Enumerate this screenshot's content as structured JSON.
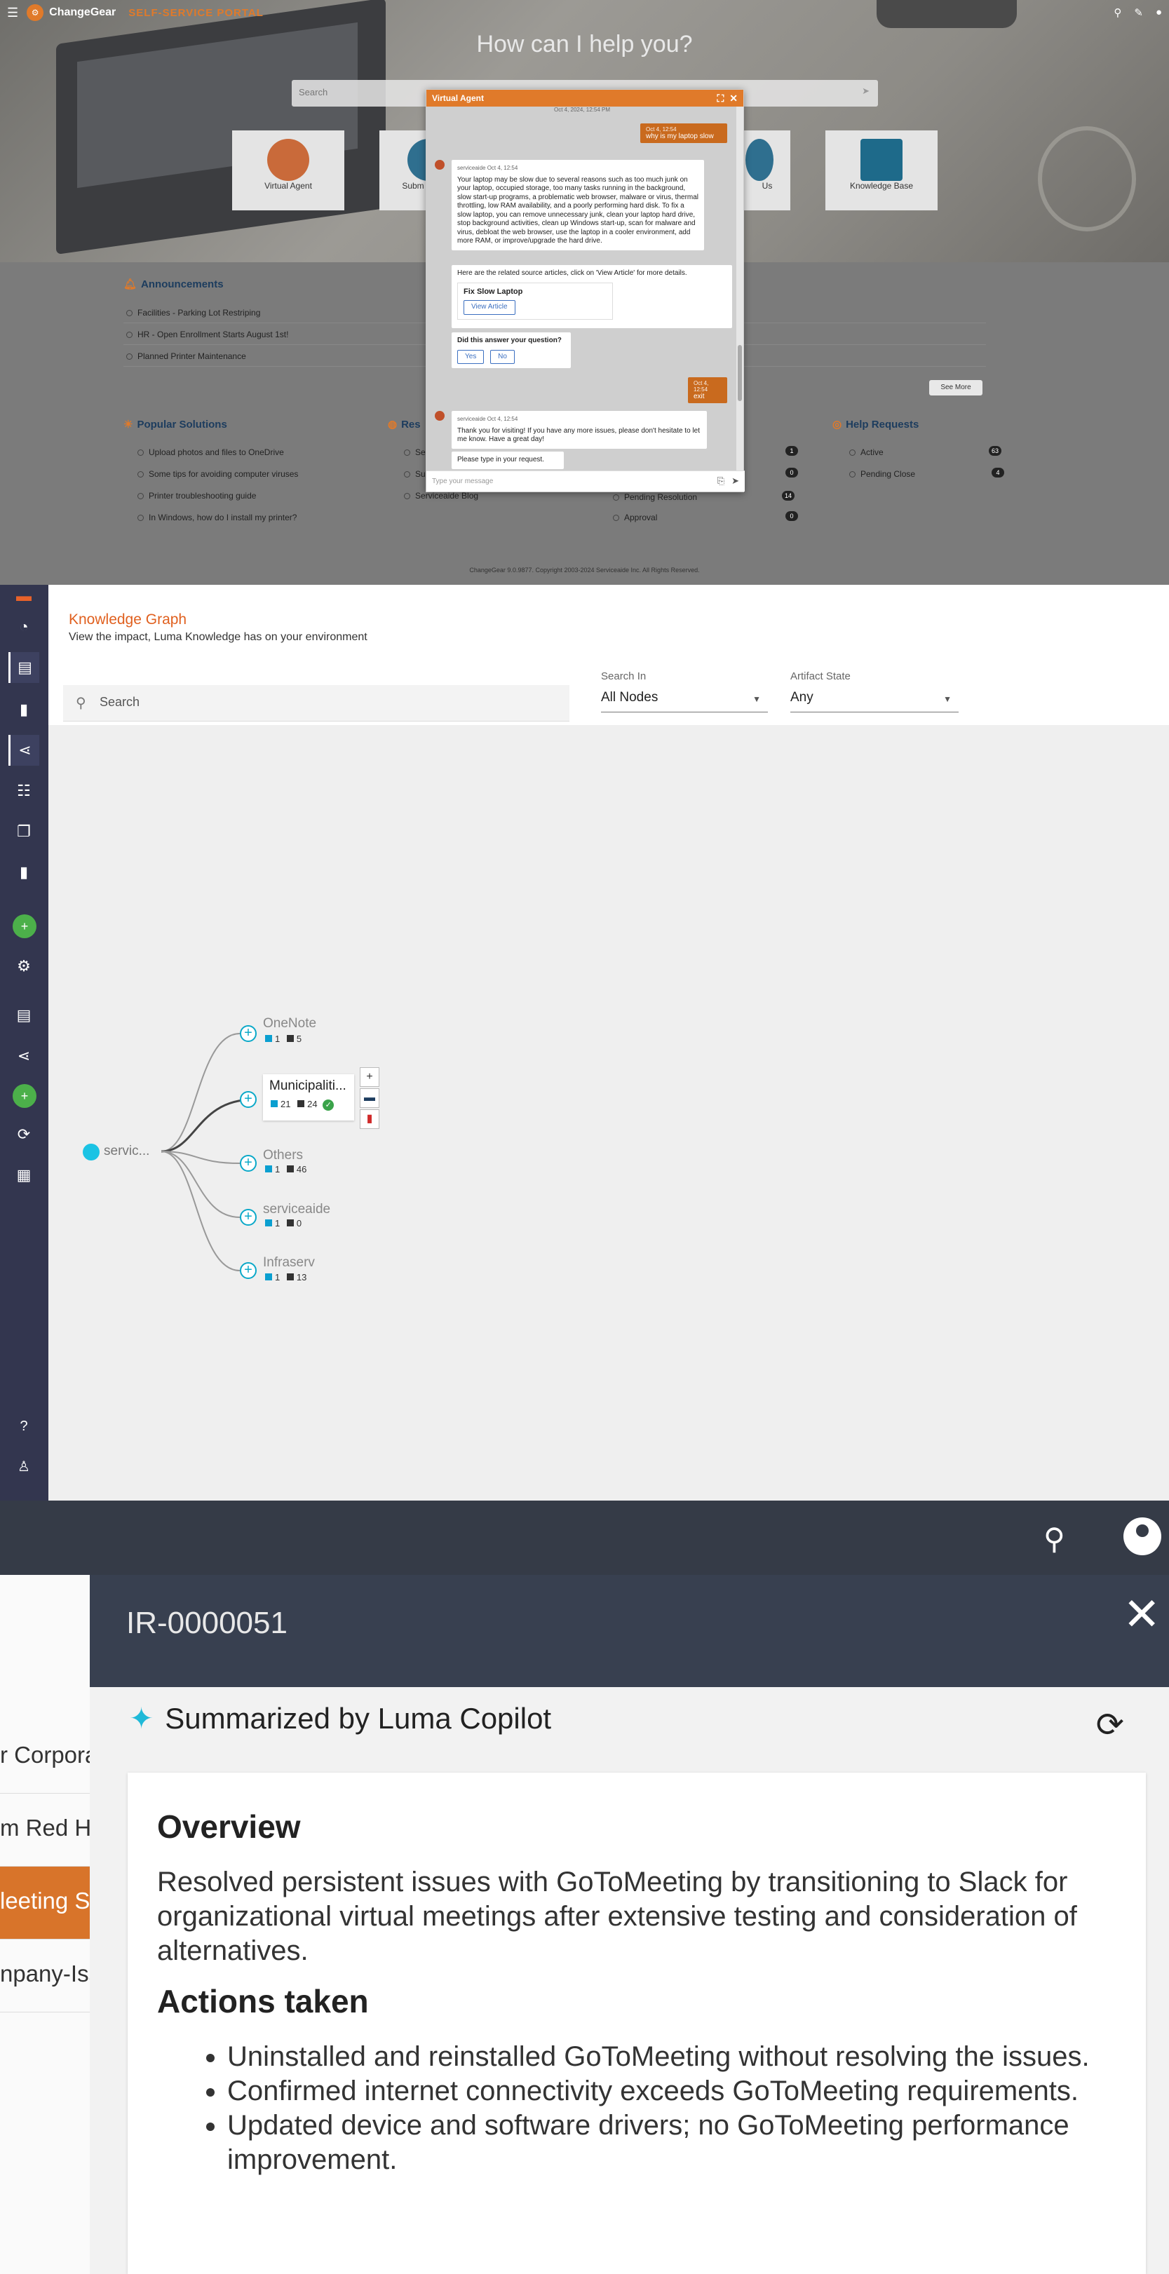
{
  "portal": {
    "brand": "ChangeGear",
    "portal_label": "SELF-SERVICE PORTAL",
    "headline": "How can I help you?",
    "search_placeholder": "Search",
    "tiles": [
      {
        "label": "Virtual Agent"
      },
      {
        "label": "Subm"
      },
      {
        "label": "Us"
      },
      {
        "label": "Knowledge Base"
      }
    ],
    "announcements_title": "Announcements",
    "announcements": [
      "Facilities - Parking Lot Restriping",
      "HR - Open Enrollment Starts August 1st!",
      "Planned Printer Maintenance"
    ],
    "see_more": "See More",
    "popular_title": "Popular Solutions",
    "popular": [
      "Upload photos and files to OneDrive",
      "Some tips for avoiding computer viruses",
      "Printer troubleshooting guide",
      "In Windows, how do I install my printer?"
    ],
    "resources_title": "Res",
    "resources": [
      "Se",
      "Su",
      "Serviceaide Blog"
    ],
    "requests": [
      {
        "label": "Pending Resolution",
        "count": "14"
      },
      {
        "label": "Approval",
        "count": "0"
      }
    ],
    "req_counts_top": [
      "1",
      "0"
    ],
    "help_title": "Help Requests",
    "help": [
      {
        "label": "Active",
        "count": "63"
      },
      {
        "label": "Pending Close",
        "count": "4"
      }
    ],
    "footer": "ChangeGear 9.0.9877. Copyright 2003-2024 Serviceaide Inc. All Rights Reserved."
  },
  "virtual_agent": {
    "title": "Virtual Agent",
    "top_stamp": "Oct 4, 2024, 12:54 PM",
    "user_msg1_time": "Oct 4, 12:54",
    "user_msg1": "why is my laptop slow",
    "bot_name": "serviceaide",
    "bot_time": "Oct 4, 12:54",
    "bot_answer": "Your laptop may be slow due to several reasons such as too much junk on your laptop, occupied storage, too many tasks running in the background, slow start-up programs, a problematic web browser, malware or virus, thermal throttling, low RAM availability, and a poorly performing hard disk. To fix a slow laptop, you can remove unnecessary junk, clean your laptop hard drive, stop background activities, clean up Windows start-up, scan for malware and virus, debloat the web browser, use the laptop in a cooler environment, add more RAM, or improve/upgrade the hard drive.",
    "related": "Here are the related source articles, click on 'View Article' for more details.",
    "article_title": "Fix Slow Laptop",
    "view_article": "View Article",
    "question": "Did this answer your question?",
    "yes": "Yes",
    "no": "No",
    "user_msg2_time": "Oct 4, 12:54",
    "user_msg2": "exit",
    "bot_bye": "Thank you for visiting! If you have any more issues, please don't hesitate to let me know. Have a great day!",
    "bot_prompt": "Please type in your request.",
    "input_placeholder": "Type your message"
  },
  "graph": {
    "title": "Knowledge Graph",
    "subtitle": "View the impact, Luma Knowledge has on your environment",
    "search_placeholder": "Search",
    "search_in_label": "Search In",
    "search_in_value": "All Nodes",
    "state_label": "Artifact State",
    "state_value": "Any",
    "root": "servic...",
    "nodes": [
      {
        "name": "OneNote",
        "a": "1",
        "b": "5"
      },
      {
        "name": "Municipaliti...",
        "a": "21",
        "b": "24"
      },
      {
        "name": "Others",
        "a": "1",
        "b": "46"
      },
      {
        "name": "serviceaide",
        "a": "1",
        "b": "0"
      },
      {
        "name": "Infraserv",
        "a": "1",
        "b": "13"
      }
    ]
  },
  "copilot": {
    "left_rows": [
      "r Corpora",
      "m Red H",
      "leeting S",
      "npany-Iss"
    ],
    "ticket": "IR-0000051",
    "summary_title": "Summarized by Luma Copilot",
    "overview_h": "Overview",
    "overview": "Resolved persistent issues with GoToMeeting by transitioning to Slack for organizational virtual meetings after extensive testing and consideration of alternatives.",
    "actions_h": "Actions taken",
    "actions": [
      "Uninstalled and reinstalled GoToMeeting without resolving the issues.",
      "Confirmed internet connectivity exceeds GoToMeeting requirements.",
      "Updated device and software drivers; no GoToMeeting performance improvement."
    ]
  }
}
